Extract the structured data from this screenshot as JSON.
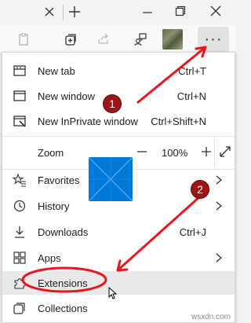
{
  "titlebar": {
    "close_tab_icon": "close-icon",
    "new_tab_icon": "plus-icon",
    "minimize_icon": "minimize-icon",
    "restore_icon": "restore-icon",
    "close_window_icon": "close-icon"
  },
  "toolbar": {
    "more_label": "···"
  },
  "menu": {
    "new_tab": {
      "label": "New tab",
      "shortcut": "Ctrl+T",
      "icon": "tab-icon"
    },
    "new_window": {
      "label": "New window",
      "shortcut": "Ctrl+N",
      "icon": "window-icon"
    },
    "new_inprivate": {
      "label": "New InPrivate window",
      "shortcut": "Ctrl+Shift+N",
      "icon": "inprivate-icon"
    },
    "zoom": {
      "label": "Zoom",
      "value": "100%"
    },
    "favorites": {
      "label": "Favorites",
      "icon": "star-icon"
    },
    "history": {
      "label": "History",
      "icon": "history-icon"
    },
    "downloads": {
      "label": "Downloads",
      "shortcut": "Ctrl+J",
      "icon": "download-icon"
    },
    "apps": {
      "label": "Apps",
      "icon": "apps-icon"
    },
    "extensions": {
      "label": "Extensions",
      "icon": "puzzle-icon"
    },
    "collections": {
      "label": "Collections",
      "icon": "collections-icon"
    }
  },
  "annotations": {
    "step1": "1",
    "step2": "2",
    "arrow_color": "#e8161d",
    "badge_color": "#9b1616"
  },
  "watermark": "wsxdn.com"
}
